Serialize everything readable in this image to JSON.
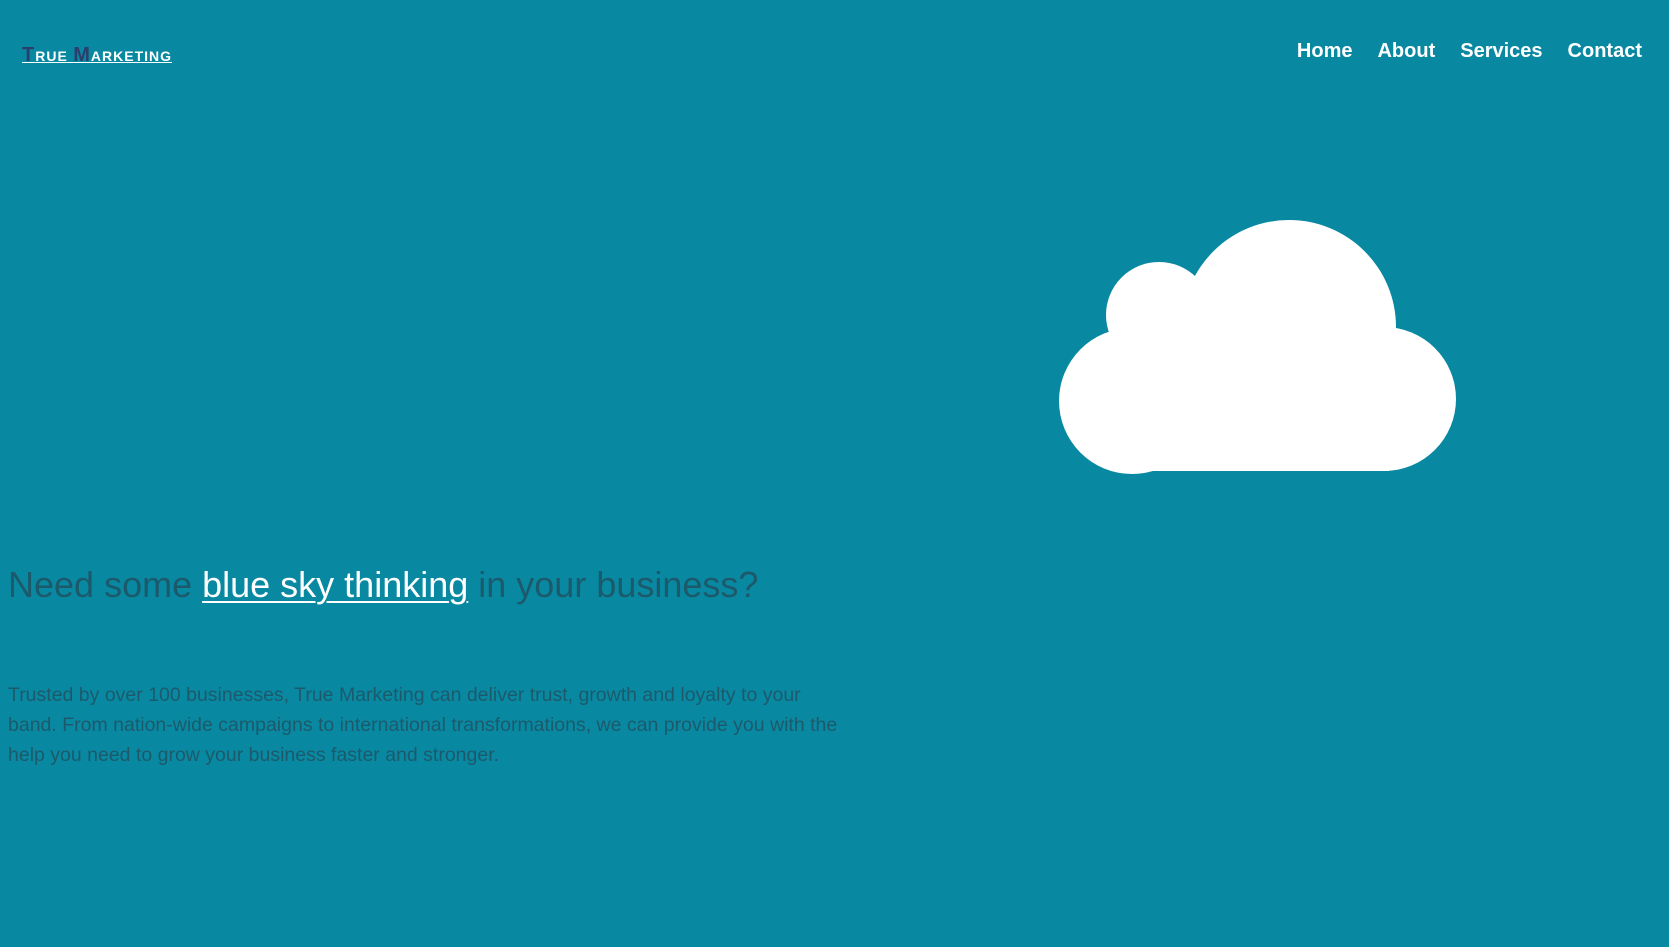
{
  "logo": {
    "first_cap": "T",
    "first_rest": "RUE",
    "second_cap": "M",
    "second_rest": "ARKETING"
  },
  "nav": {
    "items": [
      {
        "label": "Home"
      },
      {
        "label": "About"
      },
      {
        "label": "Services"
      },
      {
        "label": "Contact"
      }
    ]
  },
  "hero": {
    "icon": "cloud-icon",
    "headline_before": "Need some ",
    "headline_highlight": "blue sky thinking",
    "headline_after": " in your business?",
    "description": "Trusted by over 100 businesses, True Marketing can deliver trust, growth and loyalty to your band. From nation-wide campaigns to international transformations, we can provide you with the help you need to grow your business faster and stronger."
  },
  "colors": {
    "background": "#0988a2",
    "text_dark": "#1c5a6b",
    "logo_cap": "#2c3e6b",
    "white": "#ffffff"
  }
}
